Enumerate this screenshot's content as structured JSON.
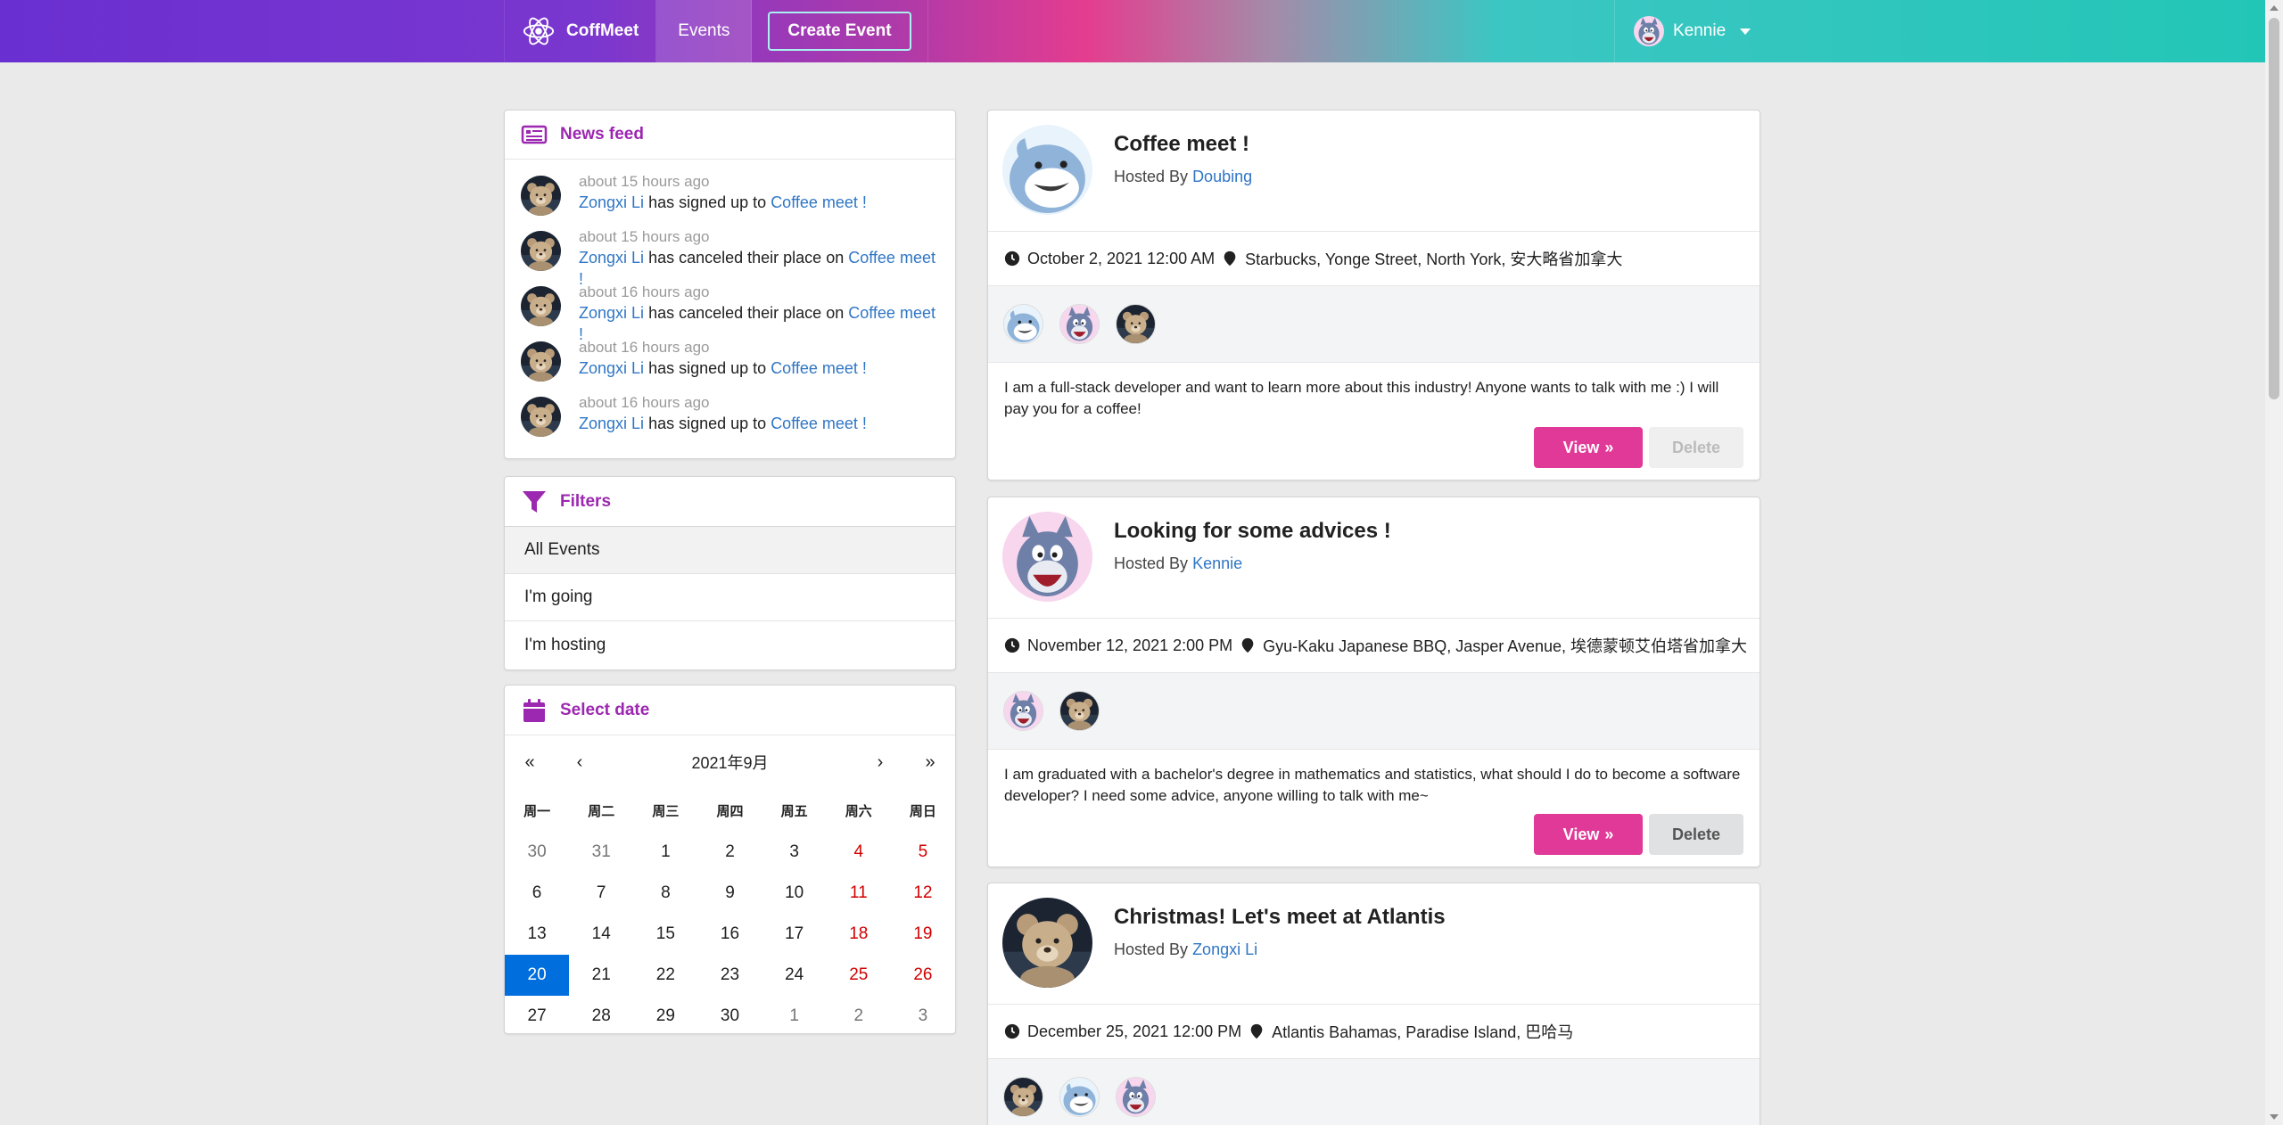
{
  "app": {
    "name": "CoffMeet"
  },
  "nav": {
    "events_label": "Events",
    "create_label": "Create Event",
    "user_name": "Kennie"
  },
  "news": {
    "title": "News feed",
    "items": [
      {
        "time": "about 15 hours ago",
        "user": "Zongxi Li",
        "action": "has signed up to",
        "event": "Coffee meet !"
      },
      {
        "time": "about 15 hours ago",
        "user": "Zongxi Li",
        "action": "has canceled their place on",
        "event": "Coffee meet !"
      },
      {
        "time": "about 16 hours ago",
        "user": "Zongxi Li",
        "action": "has canceled their place on",
        "event": "Coffee meet !"
      },
      {
        "time": "about 16 hours ago",
        "user": "Zongxi Li",
        "action": "has signed up to",
        "event": "Coffee meet !"
      },
      {
        "time": "about 16 hours ago",
        "user": "Zongxi Li",
        "action": "has signed up to",
        "event": "Coffee meet !"
      }
    ]
  },
  "filters": {
    "title": "Filters",
    "items": [
      "All Events",
      "I'm going",
      "I'm hosting"
    ],
    "active": "All Events"
  },
  "calendar": {
    "title": "Select date",
    "nav": {
      "first": "«",
      "prev": "‹",
      "next": "›",
      "last": "»"
    },
    "month": "2021年9月",
    "weekdays": [
      "周一",
      "周二",
      "周三",
      "周四",
      "周五",
      "周六",
      "周日"
    ],
    "days": [
      [
        "30",
        "31",
        "1",
        "2",
        "3",
        "4",
        "5"
      ],
      [
        "6",
        "7",
        "8",
        "9",
        "10",
        "11",
        "12"
      ],
      [
        "13",
        "14",
        "15",
        "16",
        "17",
        "18",
        "19"
      ],
      [
        "20",
        "21",
        "22",
        "23",
        "24",
        "25",
        "26"
      ],
      [
        "27",
        "28",
        "29",
        "30",
        "1",
        "2",
        "3"
      ]
    ],
    "selected": "20"
  },
  "events": [
    {
      "title": "Coffee meet !",
      "hosted_by_label": "Hosted By",
      "host": "Doubing",
      "date": "October 2, 2021 12:00 AM",
      "venue": "Starbucks, Yonge Street, North York, 安大略省加拿大",
      "description": "I am a full-stack developer and want to learn more about this industry! Anyone wants to talk with me :) I will pay you for a coffee!",
      "view_label": "View",
      "delete_label": "Delete"
    },
    {
      "title": "Looking for some advices !",
      "hosted_by_label": "Hosted By",
      "host": "Kennie",
      "date": "November 12, 2021 2:00 PM",
      "venue": "Gyu-Kaku Japanese BBQ, Jasper Avenue, 埃德蒙顿艾伯塔省加拿大",
      "description": "I am graduated with a bachelor's degree in mathematics and statistics, what should I do to become a software developer? I need some advice, anyone willing to talk with me~",
      "view_label": "View",
      "delete_label": "Delete"
    },
    {
      "title": "Christmas! Let's meet at Atlantis",
      "hosted_by_label": "Hosted By",
      "host": "Zongxi Li",
      "date": "December 25, 2021 12:00 PM",
      "venue": "Atlantis Bahamas, Paradise Island, 巴哈马"
    }
  ],
  "colors": {
    "accent": "#9c27b0",
    "pink": "#e03997",
    "link": "#2f76c5",
    "selected_day": "#006edc"
  }
}
